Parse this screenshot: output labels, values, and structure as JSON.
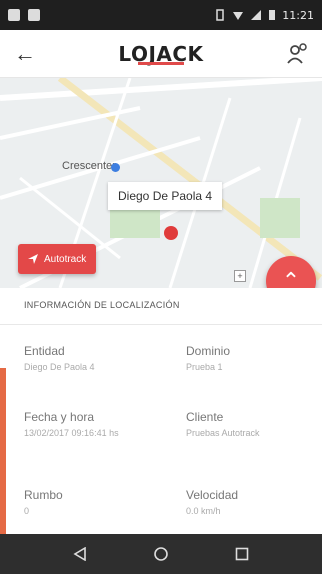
{
  "status_bar": {
    "time": "11:21"
  },
  "app_bar": {
    "logo": "LOJACK"
  },
  "map": {
    "place_label": "Crescenter",
    "marker_label": "Diego De Paola 4"
  },
  "autotrack_button": {
    "label": "Autotrack"
  },
  "info": {
    "header": "INFORMACIÓN DE LOCALIZACIÓN",
    "fields": [
      {
        "label": "Entidad",
        "value": "Diego De Paola 4"
      },
      {
        "label": "Dominio",
        "value": "Prueba 1"
      },
      {
        "label": "Fecha y hora",
        "value": "13/02/2017 09:16:41 hs"
      },
      {
        "label": "Cliente",
        "value": "Pruebas Autotrack"
      },
      {
        "label": "Rumbo",
        "value": "0"
      },
      {
        "label": "Velocidad",
        "value": "0.0 km/h"
      }
    ]
  },
  "colors": {
    "accent": "#e34848",
    "fab": "#ea5353",
    "strip": "#e56a45"
  }
}
